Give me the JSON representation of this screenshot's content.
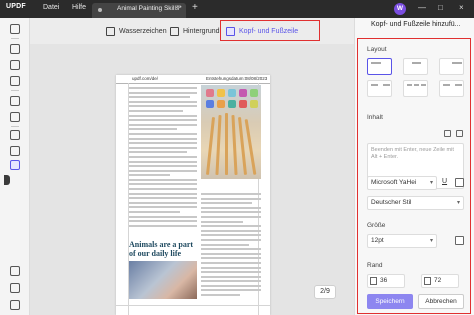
{
  "app": {
    "logo": "UPDF",
    "menu": [
      "Datei",
      "Hilfe"
    ]
  },
  "tab": {
    "title": "Animal Painting Skills*",
    "close": "×",
    "add": "+"
  },
  "user": {
    "initial": "W"
  },
  "window": {
    "minimize": "—",
    "maximize": "□",
    "close": "×"
  },
  "edit_toolbar": {
    "watermark": "Wasserzeichen",
    "background": "Hintergrund",
    "header_footer": "Kopf- und Fußzeile"
  },
  "document": {
    "header_left": "updf.com/de/",
    "header_right": "Entstehungsdatum:08/08/2023",
    "article_title": "Animals are a part of our daily life",
    "page_indicator": "2/9"
  },
  "panel": {
    "title": "Kopf- und Fußzeile hinzufü...",
    "layout_label": "Layout",
    "content_label": "Inhalt",
    "content_placeholder": "Beenden mit Enter, neue Zeile mit Alt + Enter.",
    "font": "Microsoft YaHei",
    "underline": "U",
    "style": "Deutscher Stil",
    "size_label": "Größe",
    "size": "12pt",
    "margin_label": "Rand",
    "margin_top": "36",
    "margin_bottom": "72",
    "save_label": "Speichern",
    "cancel_label": "Abbrechen"
  },
  "colors": {
    "accent": "#5a54e8",
    "highlight_box": "#e03030",
    "title_bar": "#2b2b2b"
  }
}
